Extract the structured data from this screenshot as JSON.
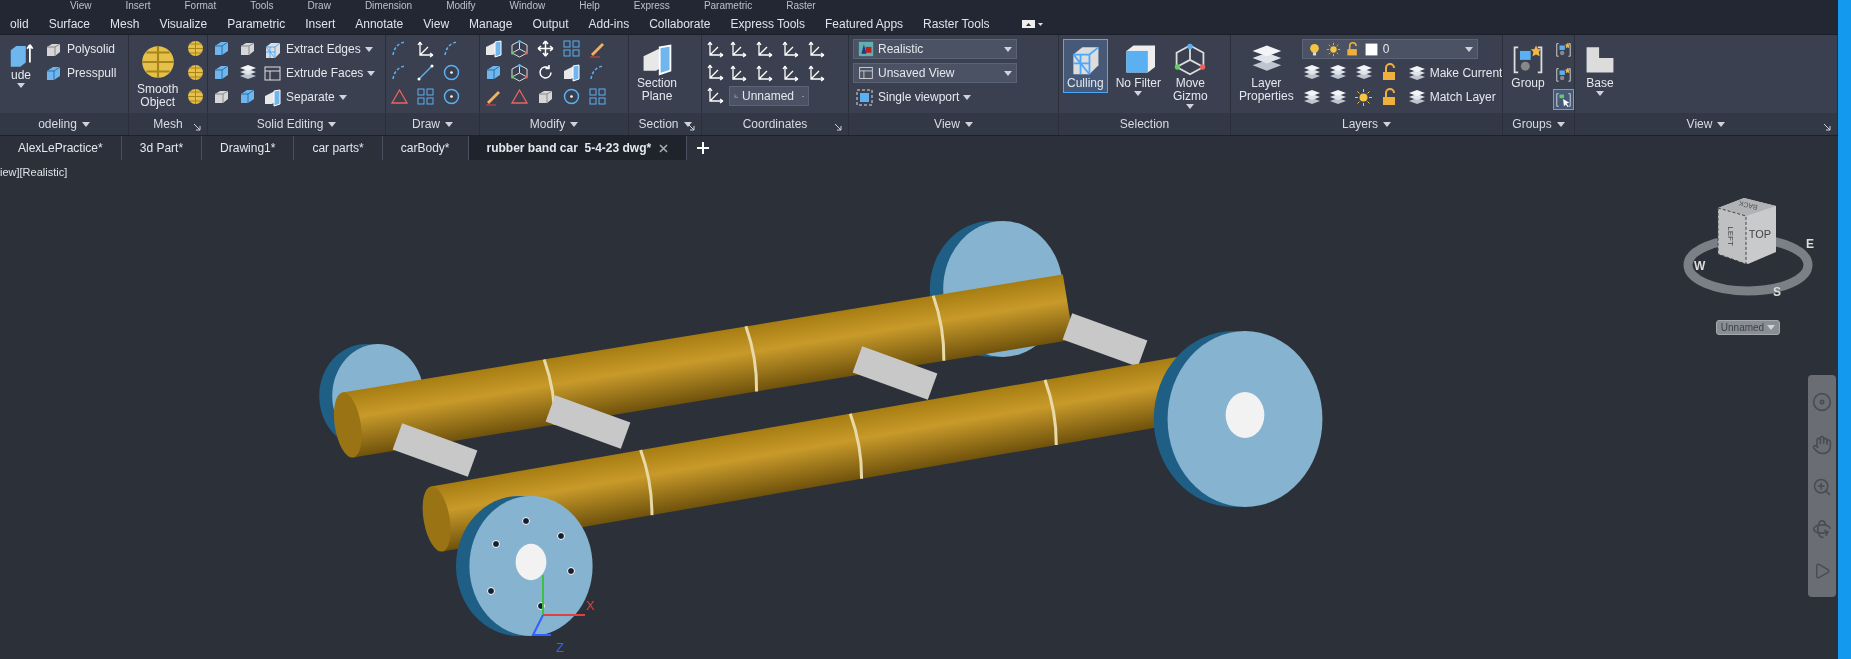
{
  "menu_bar": [
    "View",
    "Insert",
    "Format",
    "Tools",
    "Draw",
    "Dimension",
    "Modify",
    "Window",
    "Help",
    "Express",
    "Parametric",
    "Raster"
  ],
  "ribbon_tabs": [
    "olid",
    "Surface",
    "Mesh",
    "Visualize",
    "Parametric",
    "Insert",
    "Annotate",
    "View",
    "Manage",
    "Output",
    "Add-ins",
    "Collaborate",
    "Express Tools",
    "Featured Apps",
    "Raster Tools"
  ],
  "ribbon_panels": [
    {
      "kind": "modeling",
      "title": "odeling",
      "caret": true,
      "launcher": false,
      "items": [
        {
          "kind": "large",
          "label": "ude",
          "caret": true
        },
        {
          "kind": "small",
          "label": "Polysolid",
          "caret": false
        },
        {
          "kind": "small",
          "label": "Presspull",
          "caret": false
        }
      ]
    },
    {
      "kind": "mesh",
      "title": "Mesh",
      "caret": false,
      "launcher": true,
      "items": [
        {
          "kind": "large",
          "label": "Smooth\nObject",
          "caret": false
        }
      ]
    },
    {
      "kind": "solid-editing",
      "title": "Solid Editing",
      "caret": true,
      "launcher": false,
      "items": [
        {
          "kind": "small",
          "label": "Extract Edges",
          "caret": true
        },
        {
          "kind": "small",
          "label": "Extrude Faces",
          "caret": true
        },
        {
          "kind": "small",
          "label": "Separate",
          "caret": true
        }
      ]
    },
    {
      "kind": "draw",
      "title": "Draw",
      "caret": true,
      "launcher": false
    },
    {
      "kind": "modify",
      "title": "Modify",
      "caret": true,
      "launcher": false
    },
    {
      "kind": "section",
      "title": "Section",
      "caret": true,
      "launcher": true,
      "items": [
        {
          "kind": "large",
          "label": "Section\nPlane",
          "caret": false
        }
      ]
    },
    {
      "kind": "coordinates",
      "title": "Coordinates",
      "caret": false,
      "launcher": true,
      "items": [
        {
          "kind": "select",
          "label": "Unnamed",
          "caret": true
        }
      ]
    },
    {
      "kind": "view",
      "title": "View",
      "caret": true,
      "launcher": false,
      "items": [
        {
          "kind": "select",
          "label": "Realistic",
          "caret": true
        },
        {
          "kind": "select",
          "label": "Unsaved View",
          "caret": true
        },
        {
          "kind": "small",
          "label": "Single viewport",
          "caret": true
        }
      ]
    },
    {
      "kind": "selection",
      "title": "Selection",
      "caret": false,
      "launcher": false,
      "items": [
        {
          "kind": "large",
          "label": "Culling",
          "caret": false,
          "on": true
        },
        {
          "kind": "large",
          "label": "No Filter",
          "caret": true,
          "on": false
        },
        {
          "kind": "large",
          "label": "Move\nGizmo",
          "caret": true,
          "on": false
        }
      ]
    },
    {
      "kind": "layers",
      "title": "Layers",
      "caret": true,
      "launcher": false,
      "items": [
        {
          "kind": "large",
          "label": "Layer\nProperties",
          "caret": false
        },
        {
          "kind": "select",
          "label": "0",
          "caret": true
        },
        {
          "kind": "small",
          "label": "Make Current",
          "caret": false
        },
        {
          "kind": "small",
          "label": "Match Layer",
          "caret": false
        }
      ]
    },
    {
      "kind": "groups",
      "title": "Groups",
      "caret": true,
      "launcher": false,
      "items": [
        {
          "kind": "large",
          "label": "Group",
          "caret": false
        }
      ],
      "toggles": [
        {
          "on": false
        },
        {
          "on": false
        },
        {
          "on": true
        }
      ]
    },
    {
      "kind": "base-view",
      "title": "View",
      "caret": true,
      "launcher": true,
      "items": [
        {
          "kind": "large",
          "label": "Base",
          "caret": true
        }
      ]
    }
  ],
  "document_tabs": [
    {
      "label": "AlexLePractice*",
      "selected": false
    },
    {
      "label": "3d Part*",
      "selected": false
    },
    {
      "label": "Drawing1*",
      "selected": false
    },
    {
      "label": "car parts*",
      "selected": false
    },
    {
      "label": "carBody*",
      "selected": false
    },
    {
      "label": "rubber band car  5-4-23 dwg*",
      "selected": true
    }
  ],
  "viewport": {
    "label": "iew][Realistic]",
    "view_cube": {
      "faces": [
        "TOP",
        "LEFT",
        "BACK"
      ],
      "compass": [
        "W",
        "E",
        "S"
      ],
      "named_view": "Unnamed"
    },
    "ucs_labels": [
      "X",
      "Z"
    ]
  }
}
